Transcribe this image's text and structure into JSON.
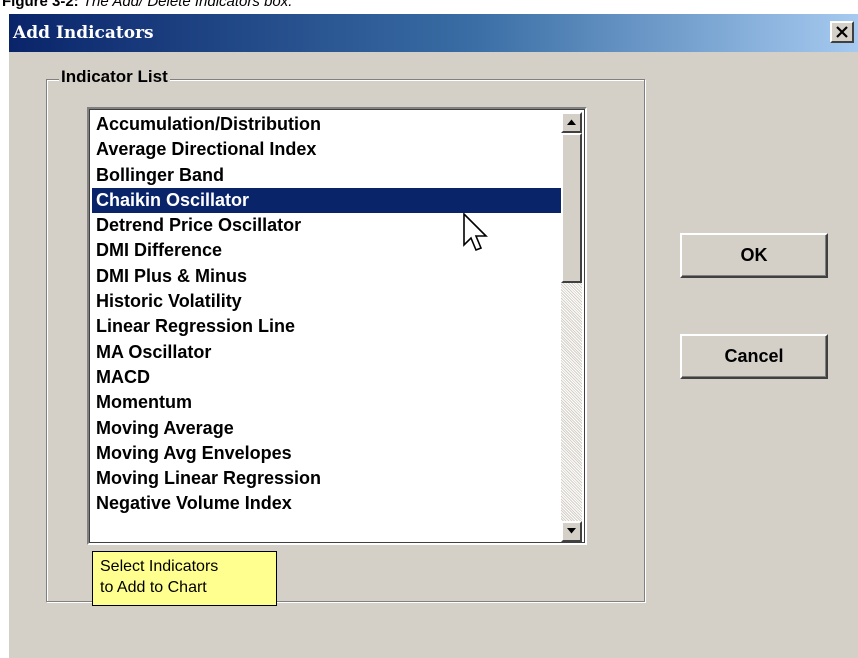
{
  "caption": {
    "figure_label": "Figure 3-2:",
    "text": " The Add/ Delete Indicators box."
  },
  "dialog": {
    "title": "Add Indicators",
    "close_glyph": "close-icon"
  },
  "group": {
    "label": "Indicator List"
  },
  "indicator_list": {
    "selected_index": 3,
    "items": [
      "Accumulation/Distribution",
      "Average Directional Index",
      "Bollinger Band",
      "Chaikin Oscillator",
      "Detrend Price Oscillator",
      "DMI Difference",
      "DMI Plus & Minus",
      "Historic Volatility",
      "Linear Regression Line",
      "MA Oscillator",
      "MACD",
      "Momentum",
      "Moving Average",
      "Moving Avg Envelopes",
      "Moving Linear Regression",
      "Negative Volume Index"
    ]
  },
  "tooltip": {
    "line1": "Select Indicators",
    "line2": "to Add to Chart"
  },
  "buttons": {
    "ok_label": "OK",
    "cancel_label": "Cancel"
  },
  "colors": {
    "title_bar_start": "#0a246a",
    "title_bar_end": "#a6caf0",
    "selection_background": "#0a246a",
    "dialog_face": "#d4d0c8",
    "tooltip_background": "#ffff90"
  }
}
